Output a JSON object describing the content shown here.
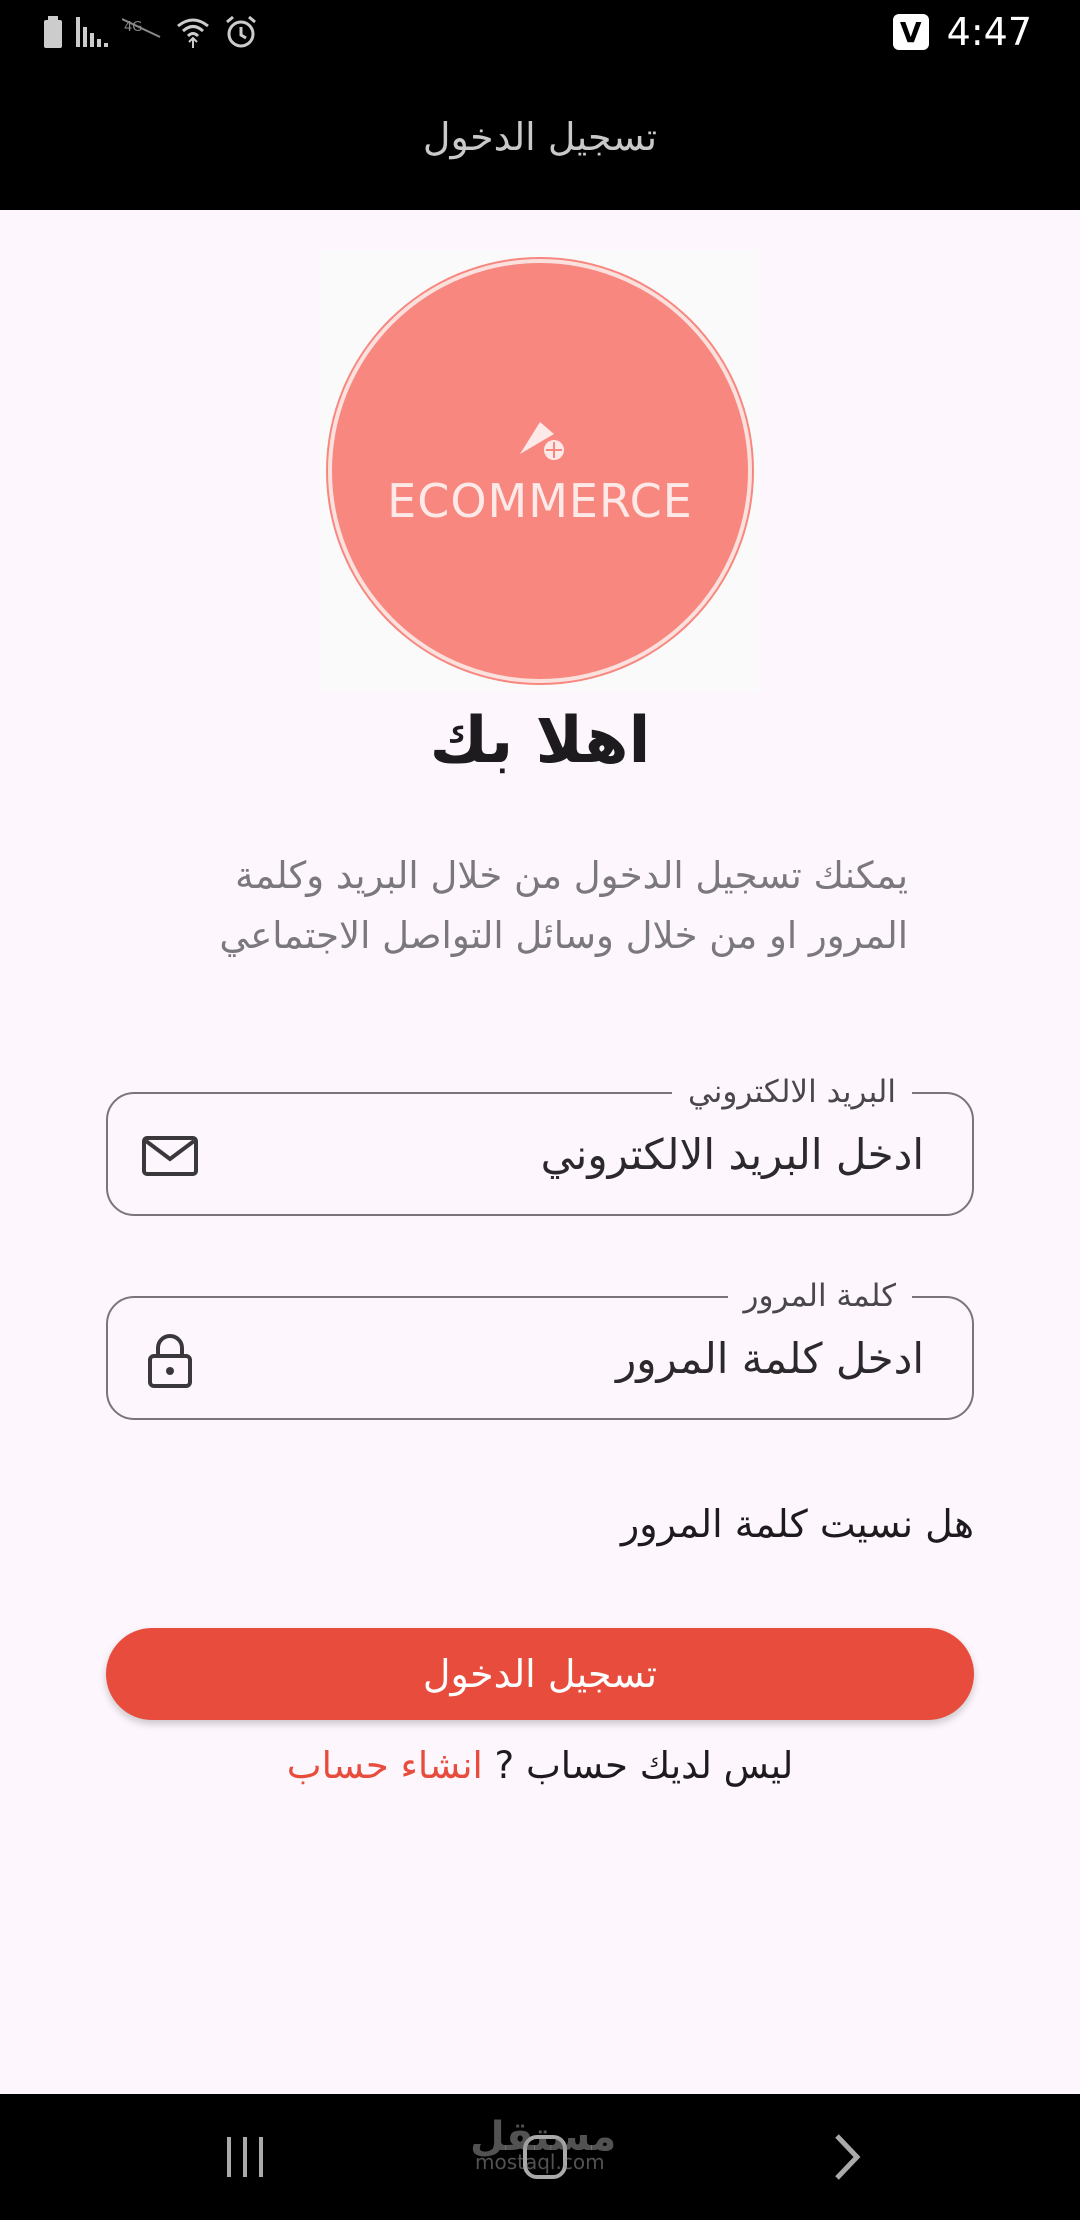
{
  "status_bar": {
    "time": "4:47",
    "badge": "V",
    "icons": [
      "battery-icon",
      "signal-icon",
      "no-4g-icon",
      "wifi-icon",
      "alarm-icon"
    ]
  },
  "app_bar": {
    "title": "تسجيل الدخول"
  },
  "logo": {
    "text": "ECOMMERCE",
    "color": "#f7877f"
  },
  "welcome": "اهلا بك",
  "description": "يمكنك تسجيل الدخول من خلال البريد وكلمة المرور او من خلال وسائل التواصل الاجتماعي",
  "email_field": {
    "label": "البريد الالكتروني",
    "placeholder": "ادخل البريد الالكتروني",
    "icon": "mail-icon"
  },
  "password_field": {
    "label": "كلمة المرور",
    "placeholder": "ادخل كلمة المرور",
    "icon": "lock-icon"
  },
  "forgot_password": "هل نسيت كلمة المرور",
  "login_button": "تسجيل الدخول",
  "signup": {
    "prompt": "ليس لديك حساب ? ",
    "link": "انشاء حساب"
  },
  "watermark": {
    "main": "مستقل",
    "sub": "mostaql.com"
  },
  "colors": {
    "primary": "#e74c3c",
    "background": "#fdf7fd",
    "bar": "#000000"
  }
}
